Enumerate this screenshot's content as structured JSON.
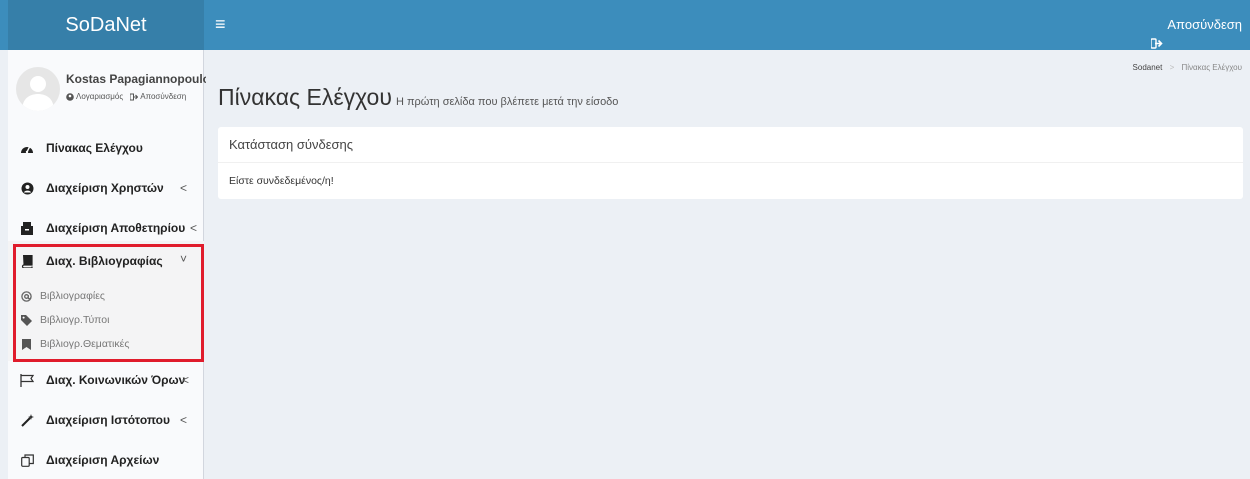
{
  "header": {
    "logo": "SoDaNet",
    "menu_toggle": "≡",
    "logout": "Αποσύνδεση"
  },
  "user": {
    "name": "Kostas Papagiannopoulo",
    "account_link": "Λογαριασμός",
    "logout_link": "Αποσύνδεση"
  },
  "sidebar": {
    "items": [
      {
        "label": "Πίνακας Ελέγχου",
        "icon": "dashboard-icon"
      },
      {
        "label": "Διαχείριση Χρηστών",
        "icon": "user-circle-icon",
        "chevron": "<"
      },
      {
        "label": "Διαχείριση Αποθετηρίου",
        "icon": "archive-icon",
        "chevron": "<"
      },
      {
        "label": "Διαχ. Βιβλιογραφίας",
        "icon": "book-icon",
        "chevron": "˅"
      },
      {
        "label": "Διαχ. Κοινωνικών Όρων",
        "icon": "flag-icon",
        "chevron": "<"
      },
      {
        "label": "Διαχείριση Ιστότοπου",
        "icon": "magic-wand-icon",
        "chevron": "<"
      },
      {
        "label": "Διαχείριση Αρχείων",
        "icon": "files-icon"
      }
    ],
    "subitems": [
      {
        "label": "Βιβλιογραφίες",
        "icon": "at-icon"
      },
      {
        "label": "Βιβλιογρ.Τύποι",
        "icon": "tag-icon"
      },
      {
        "label": "Βιβλιογρ.Θεματικές",
        "icon": "bookmark-icon"
      }
    ]
  },
  "page": {
    "title": "Πίνακας Ελέγχου",
    "subtitle": "Η πρώτη σελίδα που βλέπετε μετά την είσοδο"
  },
  "breadcrumb": {
    "root": "Sodanet",
    "separator": ">",
    "current": "Πίνακας Ελέγχου"
  },
  "status_box": {
    "title": "Κατάσταση σύνδεσης",
    "message": "Είστε συνδεδεμένος/η!"
  },
  "colors": {
    "header": "#3c8dbc",
    "logo_bg": "#367fa9",
    "highlight": "#e01c2c",
    "content_bg": "#ecf0f5"
  }
}
